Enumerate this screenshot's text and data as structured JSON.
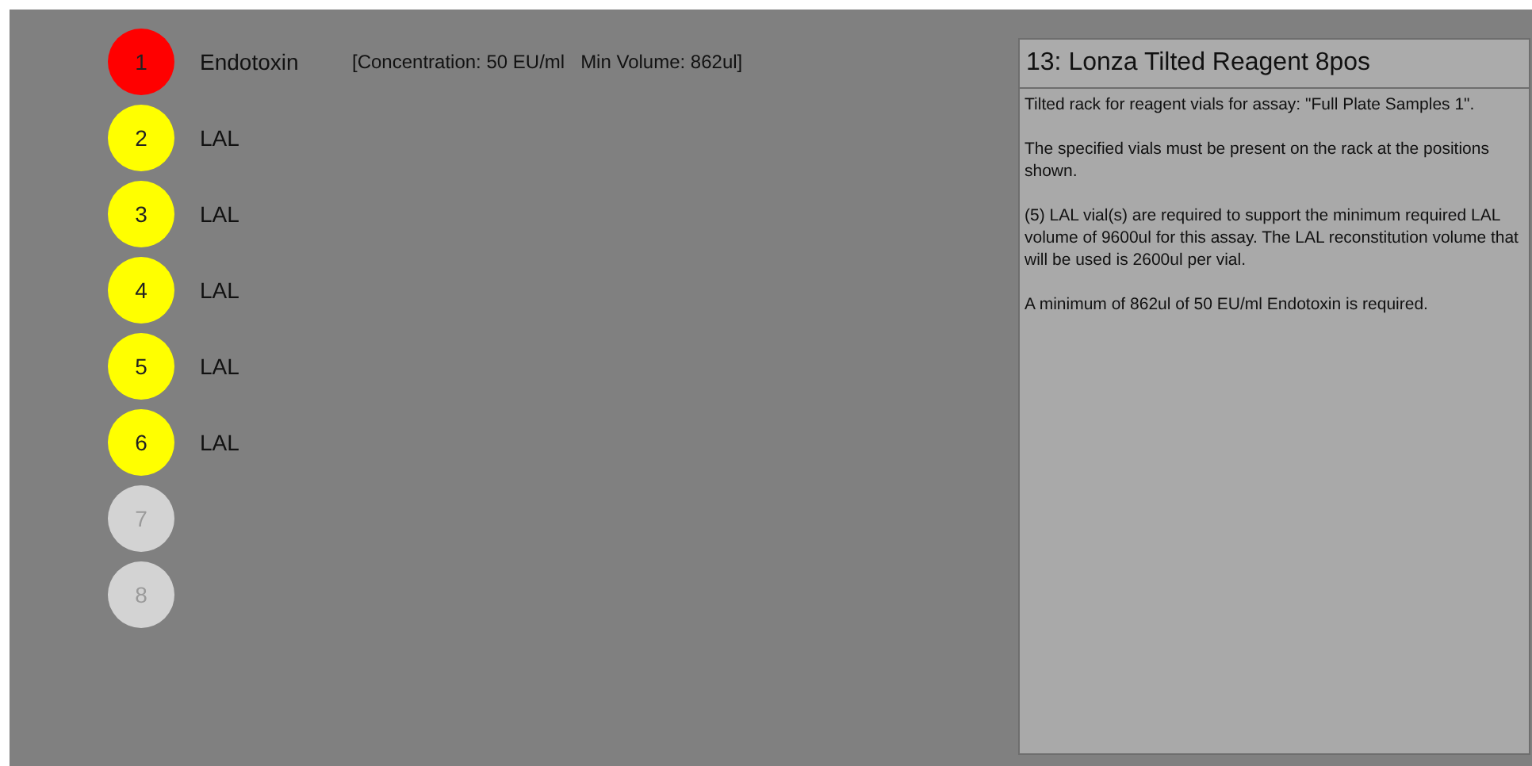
{
  "positions": [
    {
      "number": "1",
      "kind": "required",
      "color": "#ff0000",
      "label": "Endotoxin",
      "detail": "[Concentration: 50 EU/ml   Min Volume: 862ul]"
    },
    {
      "number": "2",
      "kind": "required",
      "color": "#ffff00",
      "label": "LAL"
    },
    {
      "number": "3",
      "kind": "required",
      "color": "#ffff00",
      "label": "LAL"
    },
    {
      "number": "4",
      "kind": "required",
      "color": "#ffff00",
      "label": "LAL"
    },
    {
      "number": "5",
      "kind": "required",
      "color": "#ffff00",
      "label": "LAL"
    },
    {
      "number": "6",
      "kind": "required",
      "color": "#ffff00",
      "label": "LAL"
    },
    {
      "number": "7",
      "kind": "empty",
      "color": "#d3d3d3"
    },
    {
      "number": "8",
      "kind": "empty",
      "color": "#d3d3d3"
    }
  ],
  "panel": {
    "title": "13: Lonza Tilted Reagent 8pos",
    "paragraphs": [
      "Tilted rack for reagent vials for assay: \"Full Plate Samples 1\".",
      "The specified vials must be present on the rack at the positions shown.",
      "(5) LAL vial(s) are required to support the minimum required LAL volume of 9600ul for this assay. The LAL reconstitution volume that will be used is 2600ul per vial.",
      "A minimum of 862ul of 50 EU/ml Endotoxin is required."
    ]
  }
}
